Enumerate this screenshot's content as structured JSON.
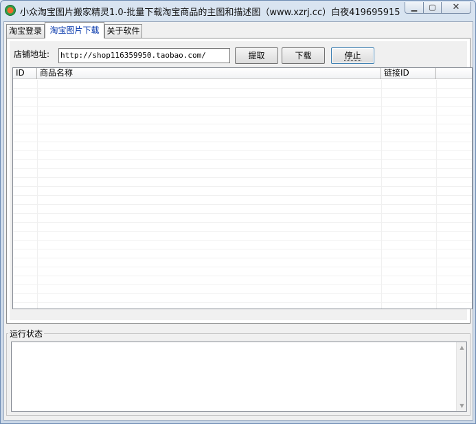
{
  "window": {
    "title": "小众淘宝图片搬家精灵1.0-批量下载淘宝商品的主图和描述图（www.xzrj.cc）白夜419695915",
    "min_glyph": "▁",
    "max_glyph": "▢",
    "close_glyph": "✕"
  },
  "tabs": [
    {
      "label": "淘宝登录"
    },
    {
      "label": "淘宝图片下载"
    },
    {
      "label": "关于软件"
    }
  ],
  "download": {
    "store_label": "店铺地址:",
    "store_url": "http://shop116359950.taobao.com/",
    "fetch_label": "提取",
    "download_label": "下载",
    "stop_label": "停止"
  },
  "list": {
    "columns": [
      "ID",
      "商品名称",
      "链接ID"
    ]
  },
  "status": {
    "group_label": "运行状态",
    "up_glyph": "▲",
    "down_glyph": "▼"
  }
}
